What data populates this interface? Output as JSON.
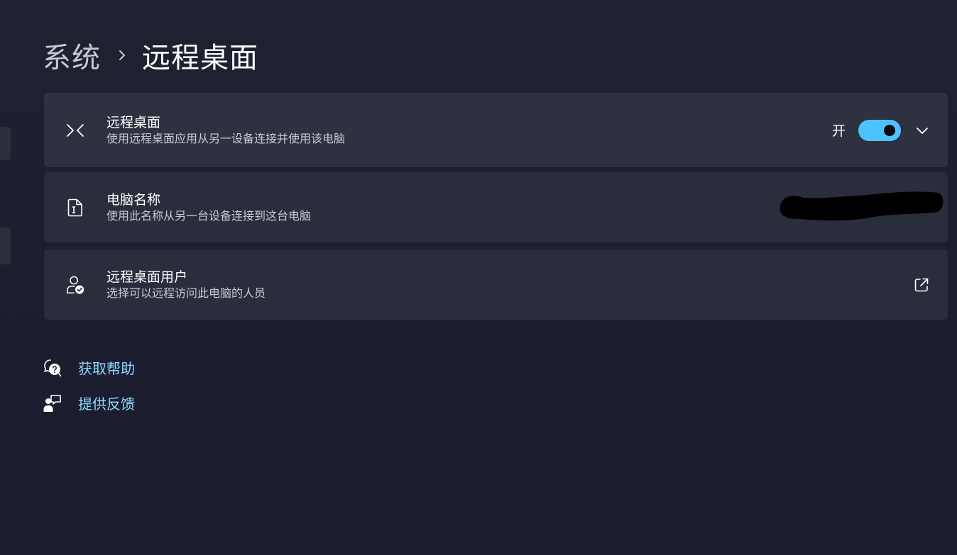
{
  "breadcrumb": {
    "parent": "系统",
    "separator_icon": "chevron-right-icon",
    "current": "远程桌面"
  },
  "settings": [
    {
      "icon": "remote-desktop-icon",
      "title": "远程桌面",
      "description": "使用远程桌面应用从另一设备连接并使用该电脑",
      "toggle": {
        "state_label": "开",
        "on": true,
        "color": "#4cc2ff"
      },
      "expand_icon": "chevron-down-icon"
    },
    {
      "icon": "pc-name-icon",
      "title": "电脑名称",
      "description": "使用此名称从另一台设备连接到这台电脑",
      "value": "redacted"
    },
    {
      "icon": "user-check-icon",
      "title": "远程桌面用户",
      "description": "选择可以远程访问此电脑的人员",
      "action_icon": "open-external-icon"
    }
  ],
  "links": [
    {
      "icon": "help-icon",
      "label": "获取帮助"
    },
    {
      "icon": "feedback-icon",
      "label": "提供反馈"
    }
  ],
  "colors": {
    "accent": "#4cc2ff",
    "link": "#8fd8ff",
    "background": "#1c1f2e",
    "card": "#2a2d3b"
  }
}
